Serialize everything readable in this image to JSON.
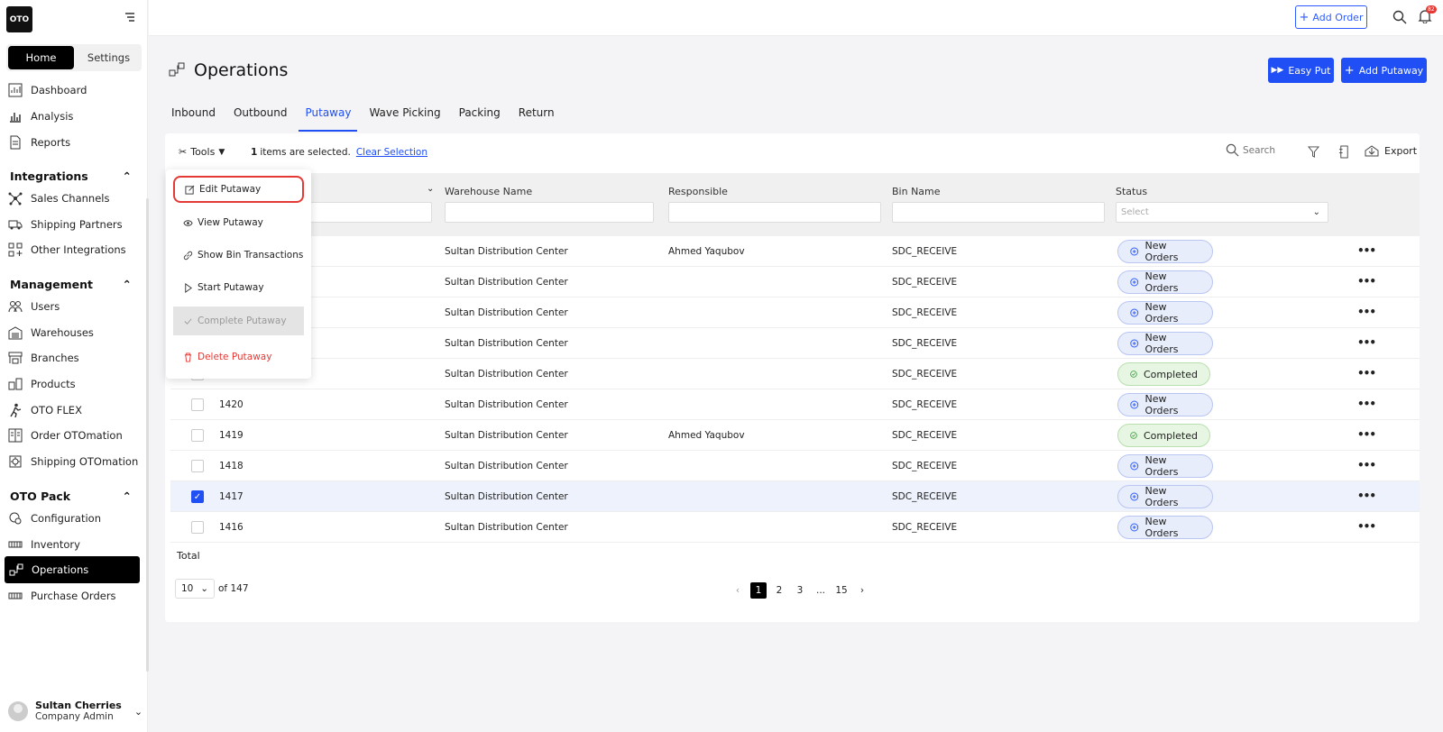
{
  "app": {
    "logo": "OTO"
  },
  "sidebar": {
    "tabs": [
      "Home",
      "Settings"
    ],
    "top_items": [
      {
        "label": "Dashboard",
        "icon": "dashboard-icon"
      },
      {
        "label": "Analysis",
        "icon": "analysis-icon"
      },
      {
        "label": "Reports",
        "icon": "reports-icon"
      }
    ],
    "sections": [
      {
        "title": "Integrations",
        "items": [
          "Sales Channels",
          "Shipping Partners",
          "Other Integrations"
        ]
      },
      {
        "title": "Management",
        "items": [
          "Users",
          "Warehouses",
          "Branches",
          "Products",
          "OTO FLEX",
          "Order OTOmation",
          "Shipping OTOmation"
        ]
      },
      {
        "title": "OTO Pack",
        "items": [
          "Configuration",
          "Inventory",
          "Operations",
          "Purchase Orders"
        ]
      }
    ],
    "active_item": "Operations",
    "user": {
      "name": "Sultan Cherries",
      "role": "Company Admin"
    }
  },
  "topbar": {
    "add_order_label": "Add Order",
    "notification_count": "82"
  },
  "page": {
    "title": "Operations",
    "easy_put_label": "Easy Put",
    "add_putaway_label": "Add Putaway",
    "tabs": [
      "Inbound",
      "Outbound",
      "Putaway",
      "Wave Picking",
      "Packing",
      "Return"
    ],
    "active_tab": "Putaway"
  },
  "toolbar": {
    "tools_label": "Tools",
    "selected_count": "1",
    "selected_text": "items are selected.",
    "clear_selection": "Clear Selection",
    "search_placeholder": "Search",
    "export_label": "Export"
  },
  "tools_menu": {
    "items": [
      "Edit Putaway",
      "View Putaway",
      "Show Bin Transactions",
      "Start Putaway",
      "Complete Putaway",
      "Delete Putaway"
    ]
  },
  "table": {
    "columns": [
      "Warehouse Name",
      "Responsible",
      "Bin Name",
      "Status"
    ],
    "status_filter_placeholder": "Select",
    "rows": [
      {
        "id": "",
        "warehouse": "Sultan Distribution Center",
        "responsible": "Ahmed Yaqubov",
        "bin": "SDC_RECEIVE",
        "status": "New Orders",
        "checked": false
      },
      {
        "id": "",
        "warehouse": "Sultan Distribution Center",
        "responsible": "",
        "bin": "SDC_RECEIVE",
        "status": "New Orders",
        "checked": false
      },
      {
        "id": "",
        "warehouse": "Sultan Distribution Center",
        "responsible": "",
        "bin": "SDC_RECEIVE",
        "status": "New Orders",
        "checked": false
      },
      {
        "id": "",
        "warehouse": "Sultan Distribution Center",
        "responsible": "",
        "bin": "SDC_RECEIVE",
        "status": "New Orders",
        "checked": false
      },
      {
        "id": "",
        "warehouse": "Sultan Distribution Center",
        "responsible": "",
        "bin": "SDC_RECEIVE",
        "status": "Completed",
        "checked": false
      },
      {
        "id": "1420",
        "warehouse": "Sultan Distribution Center",
        "responsible": "",
        "bin": "SDC_RECEIVE",
        "status": "New Orders",
        "checked": false
      },
      {
        "id": "1419",
        "warehouse": "Sultan Distribution Center",
        "responsible": "Ahmed Yaqubov",
        "bin": "SDC_RECEIVE",
        "status": "Completed",
        "checked": false
      },
      {
        "id": "1418",
        "warehouse": "Sultan Distribution Center",
        "responsible": "",
        "bin": "SDC_RECEIVE",
        "status": "New Orders",
        "checked": false
      },
      {
        "id": "1417",
        "warehouse": "Sultan Distribution Center",
        "responsible": "",
        "bin": "SDC_RECEIVE",
        "status": "New Orders",
        "checked": true
      },
      {
        "id": "1416",
        "warehouse": "Sultan Distribution Center",
        "responsible": "",
        "bin": "SDC_RECEIVE",
        "status": "New Orders",
        "checked": false
      }
    ],
    "total_label": "Total"
  },
  "pagination": {
    "page_size": "10",
    "of_text": "of 147",
    "pages": [
      "1",
      "2",
      "3",
      "...",
      "15"
    ],
    "current": "1"
  },
  "colors": {
    "accent": "#1f4ff5",
    "danger": "#e53935",
    "completed_bg": "#e6f6e2",
    "new_bg": "#e8edfb"
  }
}
